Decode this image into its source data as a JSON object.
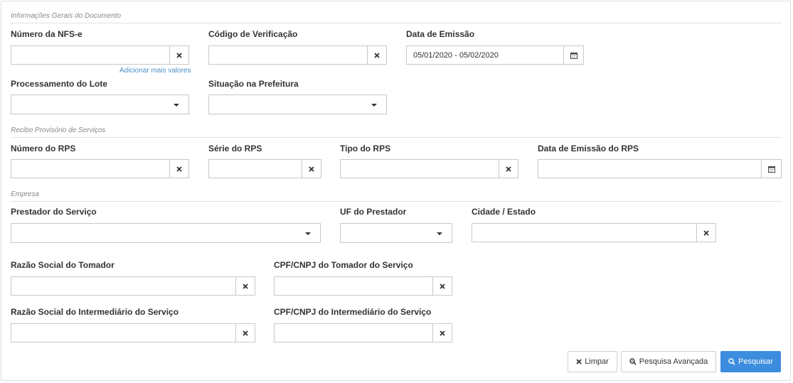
{
  "sections": {
    "general": "Informações Gerais do Documento",
    "rps": "Recibo Provisório de Serviços",
    "company": "Empresa"
  },
  "fields": {
    "numero_nfse": {
      "label": "Número da NFS-e",
      "value": ""
    },
    "add_more_values": "Adicionar mais valores",
    "codigo_verificacao": {
      "label": "Código de Verificação",
      "value": ""
    },
    "data_emissao": {
      "label": "Data de Emissão",
      "value": "05/01/2020 - 05/02/2020"
    },
    "processamento_lote": {
      "label": "Processamento do Lote",
      "value": ""
    },
    "situacao_prefeitura": {
      "label": "Situação na Prefeitura",
      "value": ""
    },
    "numero_rps": {
      "label": "Número do RPS",
      "value": ""
    },
    "serie_rps": {
      "label": "Série do RPS",
      "value": ""
    },
    "tipo_rps": {
      "label": "Tipo do RPS",
      "value": ""
    },
    "data_emissao_rps": {
      "label": "Data de Emissão do RPS",
      "value": ""
    },
    "prestador_servico": {
      "label": "Prestador do Serviço",
      "value": ""
    },
    "uf_prestador": {
      "label": "UF do Prestador",
      "value": ""
    },
    "cidade_estado": {
      "label": "Cidade / Estado",
      "value": ""
    },
    "razao_social_tomador": {
      "label": "Razão Social do Tomador",
      "value": ""
    },
    "cpf_cnpj_tomador": {
      "label": "CPF/CNPJ do Tomador do Serviço",
      "value": ""
    },
    "razao_social_intermediario": {
      "label": "Razão Social do Intermediário do Serviço",
      "value": ""
    },
    "cpf_cnpj_intermediario": {
      "label": "CPF/CNPJ do Intermediário do Serviço",
      "value": ""
    }
  },
  "buttons": {
    "limpar": "Limpar",
    "pesquisa_avancada": "Pesquisa Avançada",
    "pesquisar": "Pesquisar"
  },
  "icons": {
    "clear": "close-icon",
    "calendar": "calendar-icon",
    "dropdown": "caret-down-icon",
    "search": "search-icon",
    "zoom": "zoom-search-icon"
  },
  "colors": {
    "primary": "#3c8dde",
    "link": "#4a90c9",
    "border": "#c8c8c8"
  }
}
